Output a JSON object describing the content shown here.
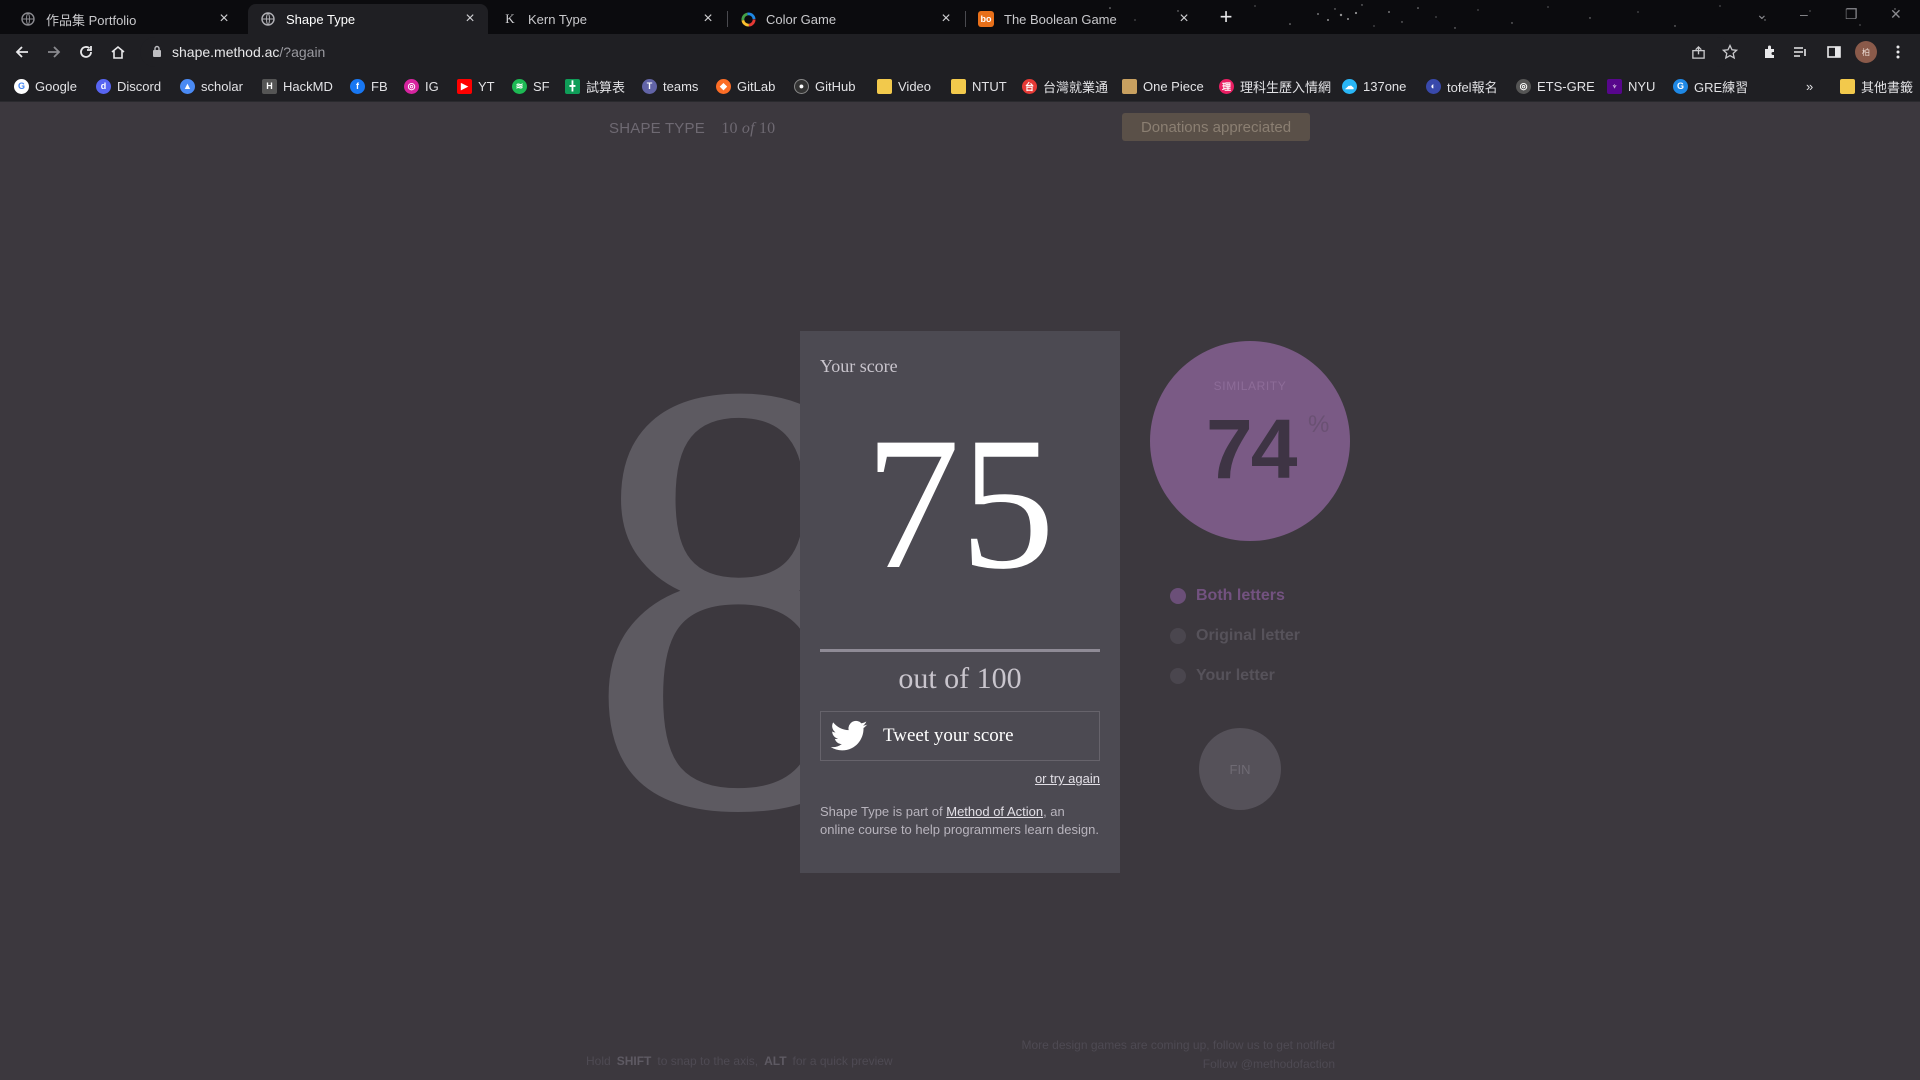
{
  "browser": {
    "tabs": [
      {
        "title": "作品集 Portfolio",
        "favicon": "globe-icon",
        "active": false
      },
      {
        "title": "Shape Type",
        "favicon": "globe-icon",
        "active": true
      },
      {
        "title": "Kern Type",
        "favicon": "k-icon",
        "active": false
      },
      {
        "title": "Color Game",
        "favicon": "color-wheel-icon",
        "active": false
      },
      {
        "title": "The Boolean Game",
        "favicon": "bo-icon",
        "active": false
      }
    ],
    "url_host": "shape.method.ac",
    "url_path": "/?again",
    "bookmarks": [
      {
        "label": "Google",
        "color": "#4285f4"
      },
      {
        "label": "Discord",
        "color": "#5865f2"
      },
      {
        "label": "scholar",
        "color": "#4a8af4"
      },
      {
        "label": "HackMD",
        "color": "#6a6a6a"
      },
      {
        "label": "FB",
        "color": "#1877f2"
      },
      {
        "label": "IG",
        "color": "#d6249f"
      },
      {
        "label": "YT",
        "color": "#ff0000"
      },
      {
        "label": "SF",
        "color": "#1db954"
      },
      {
        "label": "試算表",
        "color": "#0f9d58"
      },
      {
        "label": "teams",
        "color": "#6264a7"
      },
      {
        "label": "GitLab",
        "color": "#fc6d26"
      },
      {
        "label": "GitHub",
        "color": "#333333"
      },
      {
        "label": "Video",
        "color": "#f2c94c"
      },
      {
        "label": "NTUT",
        "color": "#f2c94c"
      },
      {
        "label": "台灣就業通",
        "color": "#e53935"
      },
      {
        "label": "One Piece",
        "color": "#c8a060"
      },
      {
        "label": "理科生歷入情網",
        "color": "#e91e63"
      },
      {
        "label": "137one",
        "color": "#29b6f6"
      },
      {
        "label": "tofel報名",
        "color": "#3949ab"
      },
      {
        "label": "ETS-GRE",
        "color": "#777777"
      },
      {
        "label": "NYU",
        "color": "#57068c"
      },
      {
        "label": "GRE練習",
        "color": "#1e88e5"
      }
    ],
    "other_bookmarks": "其他書籤",
    "overflow": "»"
  },
  "header": {
    "brand": "SHAPE TYPE",
    "progress_current": "10",
    "progress_of": "of",
    "progress_total": "10",
    "donate": "Donations appreciated"
  },
  "canvas": {
    "glyph": "8"
  },
  "score_card": {
    "label": "Your score",
    "score": "75",
    "out_of": "out of 100",
    "tweet": "Tweet your score",
    "try_again": "or try again",
    "about_pre": "Shape Type is part of ",
    "about_link": "Method of Action",
    "about_post": ", an online course to help programmers learn design."
  },
  "similarity": {
    "label": "SIMILARITY",
    "value": "74",
    "unit": "%"
  },
  "view_options": [
    {
      "label": "Both letters",
      "selected": true
    },
    {
      "label": "Original letter",
      "selected": false
    },
    {
      "label": "Your letter",
      "selected": false
    }
  ],
  "fin": "FIN",
  "footer": {
    "hint_hold": "Hold",
    "hint_shift": "SHIFT",
    "hint_shift_desc": "to snap to the axis,",
    "hint_alt": "ALT",
    "hint_alt_desc": "for a quick preview",
    "notify_line1": "More design games are coming up, follow us to get notified",
    "notify_line2": "Follow @methodofaction"
  },
  "colors": {
    "page_bg": "#3c383e",
    "card_bg": "#4c4a52",
    "similarity_bg": "#7a5a85",
    "accent_purple": "#735280"
  }
}
